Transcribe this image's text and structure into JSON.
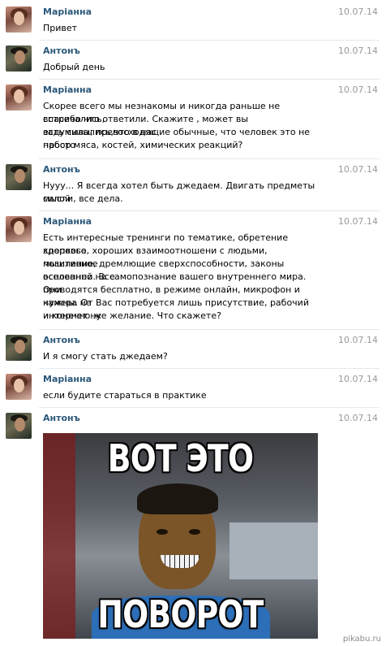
{
  "messages": [
    {
      "author": "Маріанна",
      "date": "10.07.14",
      "avatar": "female-avatar",
      "lines": [
        "Привет"
      ]
    },
    {
      "author": "Антонъ",
      "date": "10.07.14",
      "avatar": "male-avatar",
      "lines": [
        "Добрый день"
      ]
    },
    {
      "author": "Маріанна",
      "date": "10.07.14",
      "avatar": "female-avatar",
      "lines": [
        "Скорее всего мы незнакомы и никогда раньше не встречались,",
        "спасибо что ответили. Скажите , может вы задумывались,что в нас",
        "есть силы, превосходящие обычные, что человек это не просто",
        "набор мяса, костей, химических реакций?"
      ]
    },
    {
      "author": "Антонъ",
      "date": "10.07.14",
      "avatar": "male-avatar",
      "lines": [
        "Нууу... Я всегда хотел быть джедаем. Двигать предметы силой",
        "мысли, все дела."
      ]
    },
    {
      "author": "Маріанна",
      "date": "10.07.14",
      "avatar": "female-avatar",
      "lines": [
        "Есть интересные тренинги по тематике, обретение крепкого",
        "здоровье, хороших взаимоотношени с людьми, позитивное",
        "мышление, дремлющие сверхспособности, законы вселенной. Все",
        "основанно на самопознание вашего внутреннего мира. Они",
        "проводятся бесплатно, в режиме онлайн, микрофон и камера не",
        "нужны. От Вас потребуется лишь присутствие, рабочий интернет ну",
        "и конечно же желание. Что скажете?"
      ]
    },
    {
      "author": "Антонъ",
      "date": "10.07.14",
      "avatar": "male-avatar",
      "lines": [
        "И я смогу стать джедаем?"
      ]
    },
    {
      "author": "Маріанна",
      "date": "10.07.14",
      "avatar": "female-avatar",
      "lines": [
        "если будите стараться в практике"
      ]
    },
    {
      "author": "Антонъ",
      "date": "10.07.14",
      "avatar": "male-avatar",
      "lines": []
    }
  ],
  "meme": {
    "top_text": "ВОТ ЭТО",
    "bottom_text": "ПОВОРОТ"
  },
  "watermark": "pikabu.ru",
  "colors": {
    "author_name": "#2b587a",
    "date": "#999999",
    "divider": "#e4e8ed"
  }
}
